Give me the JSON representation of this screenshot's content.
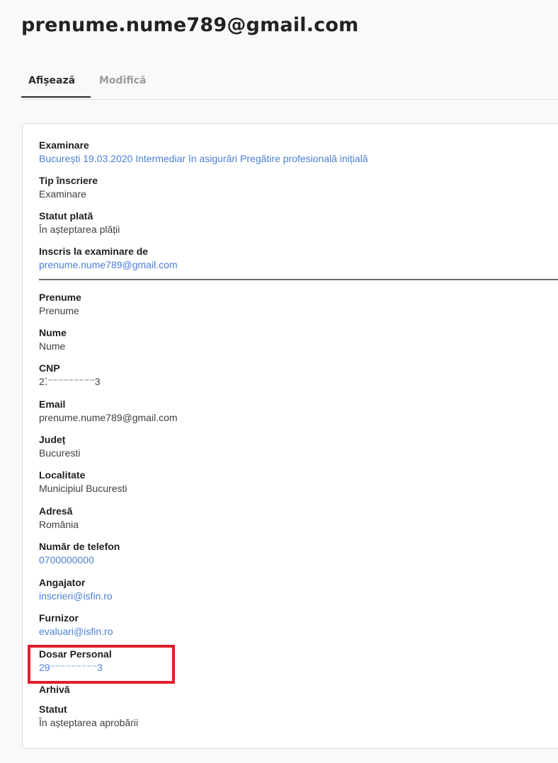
{
  "header": {
    "title": "prenume.nume789@gmail.com"
  },
  "tabs": [
    {
      "label": "Afișează",
      "active": true
    },
    {
      "label": "Modifică",
      "active": false
    }
  ],
  "exam": {
    "examinare_label": "Examinare",
    "examinare_value": "București 19.03.2020 Intermediar în asigurări Pregătire profesională inițială",
    "tip_label": "Tip înscriere",
    "tip_value": "Examinare",
    "statut_plata_label": "Statut plată",
    "statut_plata_value": "În așteptarea plății",
    "inscris_label": "Inscris la examinare de",
    "inscris_value": "prenume.nume789@gmail.com"
  },
  "personal": {
    "prenume_label": "Prenume",
    "prenume_value": "Prenume",
    "nume_label": "Nume",
    "nume_value": "Nume",
    "cnp_label": "CNP",
    "cnp_value": "2⁚⁻⁻⁻⁻⁻⁻⁻⁻⁻3",
    "email_label": "Email",
    "email_value": "prenume.nume789@gmail.com",
    "judet_label": "Județ",
    "judet_value": "Bucuresti",
    "localitate_label": "Localitate",
    "localitate_value": "Municipiul Bucuresti",
    "adresa_label": "Adresă",
    "adresa_value": "România",
    "telefon_label": "Număr de telefon",
    "telefon_value": "0700000000",
    "angajator_label": "Angajator",
    "angajator_value": "inscrieri@isfin.ro",
    "furnizor_label": "Furnizor",
    "furnizor_value": "evaluari@isfin.ro",
    "dosar_label": "Dosar Personal",
    "dosar_value": "29⁻⁻⁻⁻⁻⁻⁻⁻⁻3",
    "arhiva_label": "Arhivă",
    "statut_label": "Statut",
    "statut_value": "În așteptarea aprobării"
  },
  "colors": {
    "link": "#4a7fd4",
    "highlight": "#e11d2a"
  }
}
